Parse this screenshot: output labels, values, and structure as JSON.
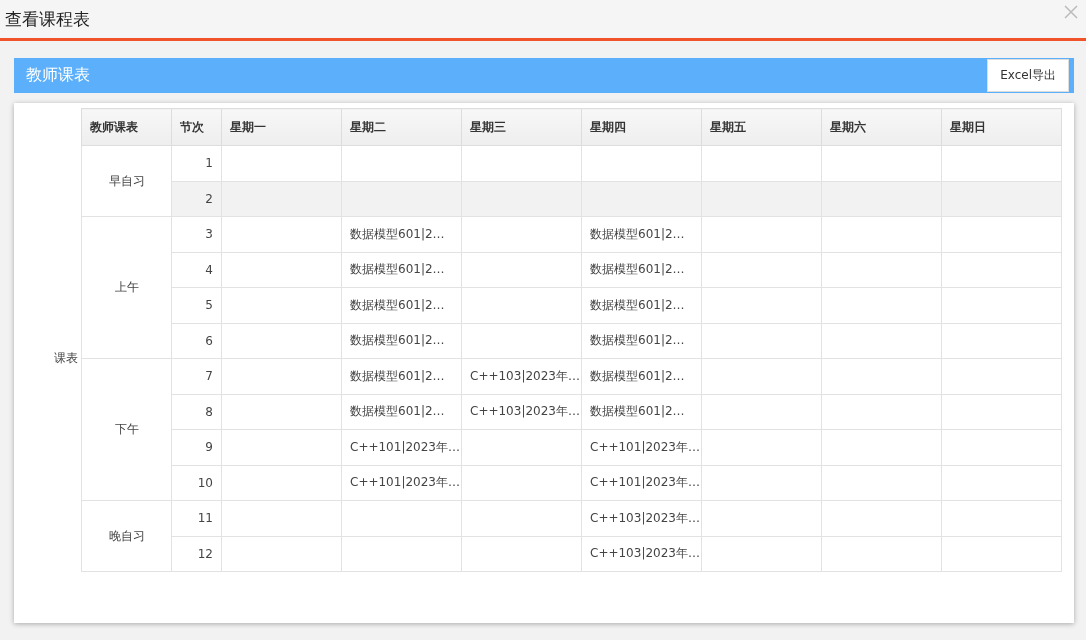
{
  "window": {
    "title": "查看课程表"
  },
  "panel": {
    "title": "教师课表",
    "export_button": "Excel导出"
  },
  "side_label": "课表",
  "table": {
    "columns": [
      "教师课表",
      "节次",
      "星期一",
      "星期二",
      "星期三",
      "星期四",
      "星期五",
      "星期六",
      "星期日"
    ],
    "groups": [
      {
        "name": "早自习",
        "periods": [
          {
            "number": "1",
            "selected": false,
            "cells": [
              null,
              null,
              null,
              null,
              null,
              null,
              null
            ]
          },
          {
            "number": "2",
            "selected": true,
            "cells": [
              null,
              null,
              null,
              null,
              null,
              null,
              null
            ]
          }
        ]
      },
      {
        "name": "上午",
        "periods": [
          {
            "number": "3",
            "selected": false,
            "cells": [
              null,
              "数据模型601|2…",
              null,
              "数据模型601|2…",
              null,
              null,
              null
            ]
          },
          {
            "number": "4",
            "selected": false,
            "cells": [
              null,
              "数据模型601|2…",
              null,
              "数据模型601|2…",
              null,
              null,
              null
            ]
          },
          {
            "number": "5",
            "selected": false,
            "cells": [
              null,
              "数据模型601|2…",
              null,
              "数据模型601|2…",
              null,
              null,
              null
            ]
          },
          {
            "number": "6",
            "selected": false,
            "cells": [
              null,
              "数据模型601|2…",
              null,
              "数据模型601|2…",
              null,
              null,
              null
            ]
          }
        ]
      },
      {
        "name": "下午",
        "periods": [
          {
            "number": "7",
            "selected": false,
            "cells": [
              null,
              "数据模型601|2…",
              "C++103|2023年…",
              "数据模型601|2…",
              null,
              null,
              null
            ]
          },
          {
            "number": "8",
            "selected": false,
            "cells": [
              null,
              "数据模型601|2…",
              "C++103|2023年…",
              "数据模型601|2…",
              null,
              null,
              null
            ]
          },
          {
            "number": "9",
            "selected": false,
            "cells": [
              null,
              "C++101|2023年…",
              null,
              "C++101|2023年…",
              null,
              null,
              null
            ]
          },
          {
            "number": "10",
            "selected": false,
            "cells": [
              null,
              "C++101|2023年…",
              null,
              "C++101|2023年…",
              null,
              null,
              null
            ]
          }
        ]
      },
      {
        "name": "晚自习",
        "periods": [
          {
            "number": "11",
            "selected": false,
            "cells": [
              null,
              null,
              null,
              "C++103|2023年…",
              null,
              null,
              null
            ]
          },
          {
            "number": "12",
            "selected": false,
            "cells": [
              null,
              null,
              null,
              "C++103|2023年…",
              null,
              null,
              null
            ]
          }
        ]
      }
    ]
  }
}
